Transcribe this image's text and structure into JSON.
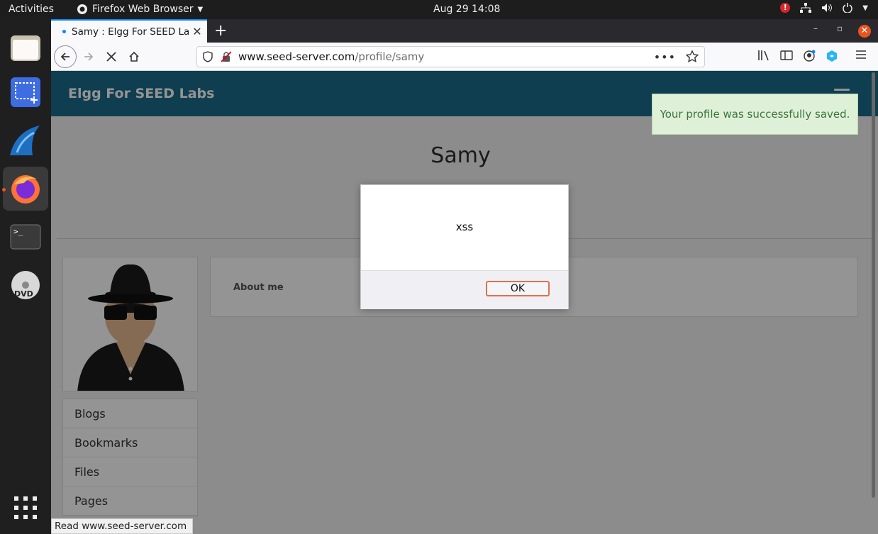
{
  "system": {
    "activities_label": "Activities",
    "app_menu_label": "Firefox Web Browser",
    "clock": "Aug 29  14:08",
    "alert_badge": "!"
  },
  "dock": {
    "items": [
      "files",
      "screenshot",
      "wireshark",
      "firefox",
      "terminal",
      "dvd",
      "app-grid"
    ]
  },
  "browser": {
    "tab_title": "Samy : Elgg For SEED Lab",
    "tab_close": "✕",
    "new_tab": "+",
    "url_host": "www.seed-server.com",
    "url_path": "/profile/samy",
    "status_text": "Read www.seed-server.com"
  },
  "page": {
    "brand": "Elgg For SEED Labs",
    "success_message": "Your profile was successfully saved.",
    "profile_name": "Samy",
    "about_label": "About me",
    "menu_items": [
      "Blogs",
      "Bookmarks",
      "Files",
      "Pages"
    ]
  },
  "dialog": {
    "message": "xss",
    "ok_label": "OK"
  },
  "colors": {
    "header": "#1a6b8a",
    "accent": "#e95420",
    "success_bg": "#dff0d8"
  }
}
